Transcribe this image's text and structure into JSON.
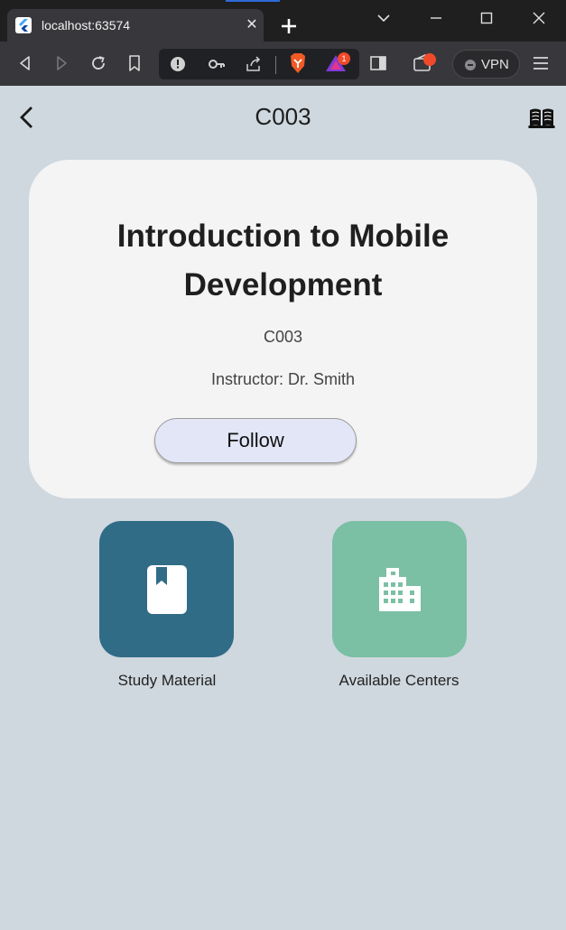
{
  "browser": {
    "tab_title": "localhost:63574",
    "tab_close": "✕",
    "vpn_label": "VPN",
    "brave_rewards_count": "1"
  },
  "app": {
    "title": "C003",
    "course": {
      "name": "Introduction to Mobile Development",
      "code": "C003",
      "instructor": "Instructor: Dr. Smith",
      "follow_label": "Follow"
    },
    "tiles": [
      {
        "label": "Study Material",
        "icon": "book-icon",
        "color": "#316c87"
      },
      {
        "label": "Available Centers",
        "icon": "building-icon",
        "color": "#7bbfa4"
      }
    ]
  },
  "colors": {
    "background": "#cfd8df",
    "card": "#f4f4f4",
    "follow_button": "#e3e6f7"
  }
}
